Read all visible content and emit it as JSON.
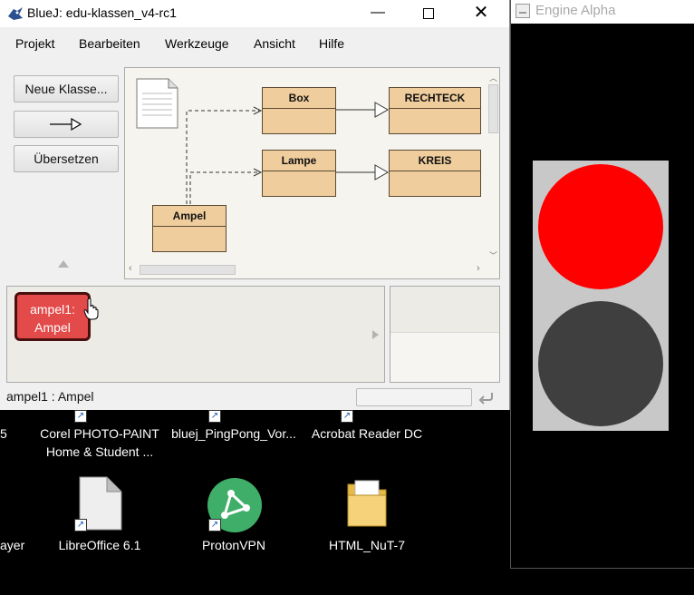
{
  "bluej": {
    "title": "BlueJ:  edu-klassen_v4-rc1",
    "menu": [
      "Projekt",
      "Bearbeiten",
      "Werkzeuge",
      "Ansicht",
      "Hilfe"
    ],
    "buttons": {
      "new_class": "Neue Klasse...",
      "compile": "Übersetzen"
    },
    "classes": {
      "box": "Box",
      "rechteck": "RECHTECK",
      "lampe": "Lampe",
      "kreis": "KREIS",
      "ampel": "Ampel"
    },
    "object": {
      "line1": "ampel1:",
      "line2": "Ampel",
      "color": "#e34a4a"
    },
    "status": "ampel1 : Ampel"
  },
  "engine": {
    "title": "Engine Alpha",
    "top_light_color": "#ff0000",
    "bottom_light_color": "#3f3f3f"
  },
  "desktop": {
    "icons": [
      {
        "label1": "Corel PHOTO-PAINT",
        "label2": "Home & Student ..."
      },
      {
        "label1": "bluej_PingPong_Vor..."
      },
      {
        "label1": "Acrobat Reader DC"
      },
      {
        "label1": "LibreOffice 6.1"
      },
      {
        "label1": "ProtonVPN"
      },
      {
        "label1": "HTML_NuT-7"
      }
    ],
    "partial_left_top": "5",
    "partial_left_bottom": "ayer"
  }
}
